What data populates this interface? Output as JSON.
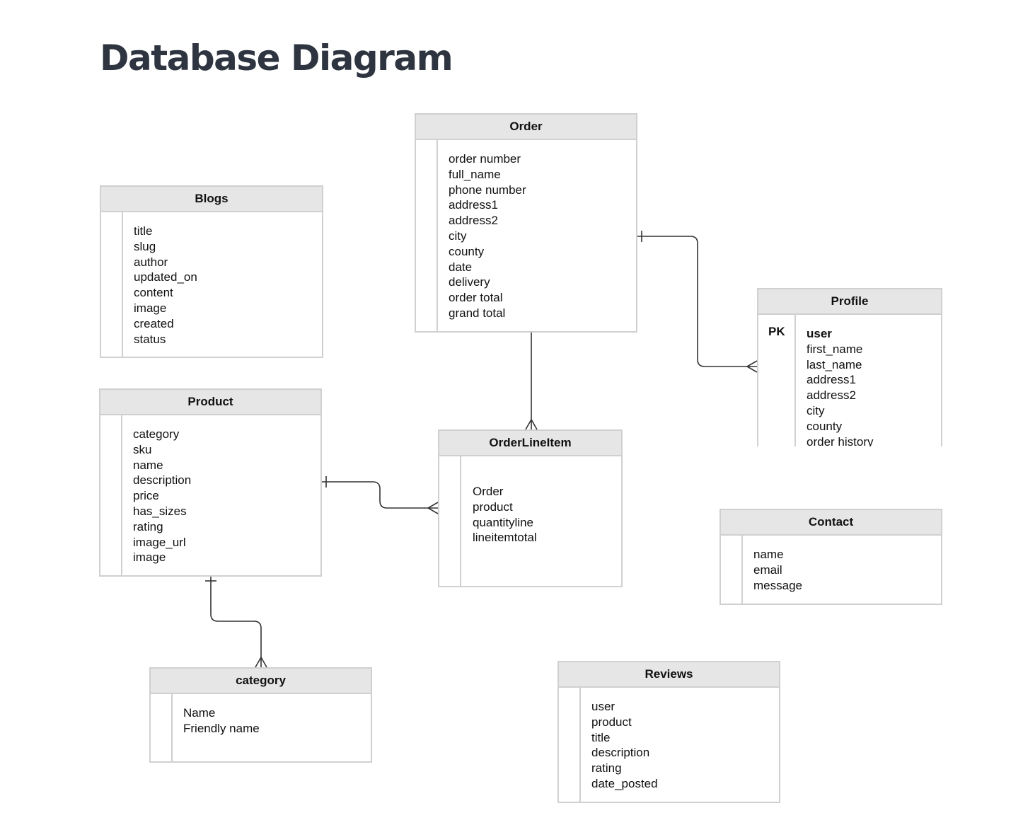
{
  "page": {
    "title": "Database Diagram"
  },
  "entities": {
    "order": {
      "name": "Order",
      "fields": [
        "order number",
        "full_name",
        "phone number",
        "address1",
        "address2",
        "city",
        "county",
        "date",
        "delivery",
        "order total",
        "grand total"
      ]
    },
    "blogs": {
      "name": "Blogs",
      "fields": [
        "title",
        "slug",
        "author",
        "updated_on",
        "content",
        "image",
        "created",
        "status"
      ]
    },
    "profile": {
      "name": "Profile",
      "pk_label": "PK",
      "fields": [
        "user",
        "first_name",
        "last_name",
        "address1",
        "address2",
        "city",
        "county",
        "order history"
      ]
    },
    "product": {
      "name": "Product",
      "fields": [
        "category",
        "sku",
        "name",
        "description",
        "price",
        "has_sizes",
        "rating",
        "image_url",
        "image"
      ]
    },
    "orderlineitem": {
      "name": "OrderLineItem",
      "fields": [
        "Order",
        "product",
        "quantityline",
        "lineitemtotal"
      ]
    },
    "contact": {
      "name": "Contact",
      "fields": [
        "name",
        "email",
        "message"
      ]
    },
    "category": {
      "name": "category",
      "fields": [
        "Name",
        "Friendly name"
      ]
    },
    "reviews": {
      "name": "Reviews",
      "fields": [
        "user",
        "product",
        "title",
        "description",
        "rating",
        "date_posted"
      ]
    }
  },
  "relationships": [
    {
      "from": "Order",
      "to": "Profile",
      "from_end": "one",
      "to_end": "many"
    },
    {
      "from": "Order",
      "to": "OrderLineItem",
      "from_end": "none",
      "to_end": "many"
    },
    {
      "from": "Product",
      "to": "OrderLineItem",
      "from_end": "one",
      "to_end": "many"
    },
    {
      "from": "Product",
      "to": "category",
      "from_end": "one",
      "to_end": "many"
    }
  ],
  "colors": {
    "title": "#2e3540",
    "header_bg": "#e6e6e6",
    "border": "#d0d0d0",
    "line": "#333333"
  }
}
